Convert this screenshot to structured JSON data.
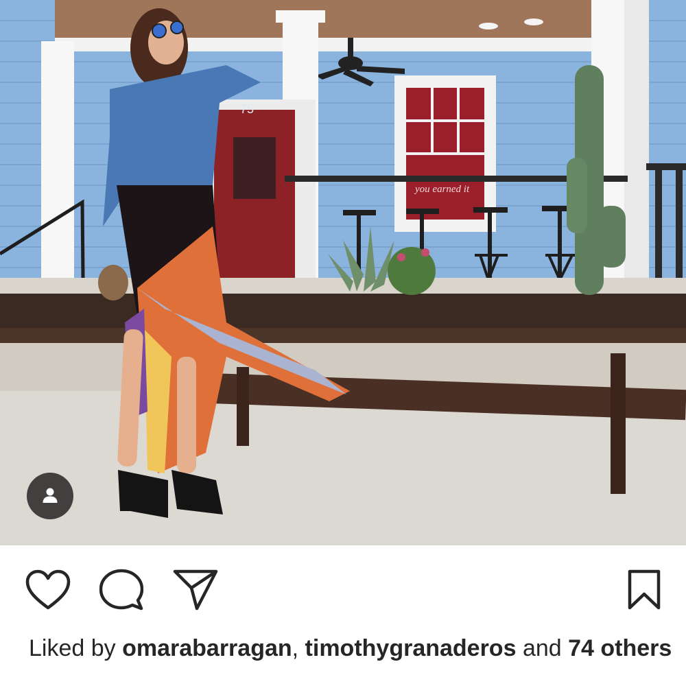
{
  "post": {
    "photo": {
      "door_number": "75",
      "window_sign": "you earned it"
    },
    "tag_people_icon": "person-icon"
  },
  "actions": {
    "like_icon": "heart-icon",
    "comment_icon": "comment-bubble-icon",
    "share_icon": "paper-plane-icon",
    "save_icon": "bookmark-icon"
  },
  "likes": {
    "prefix": "Liked by ",
    "users": [
      "omarabarragan",
      "timothygranaderos"
    ],
    "separator": ", ",
    "conjunction": " and ",
    "others": "74 others"
  }
}
